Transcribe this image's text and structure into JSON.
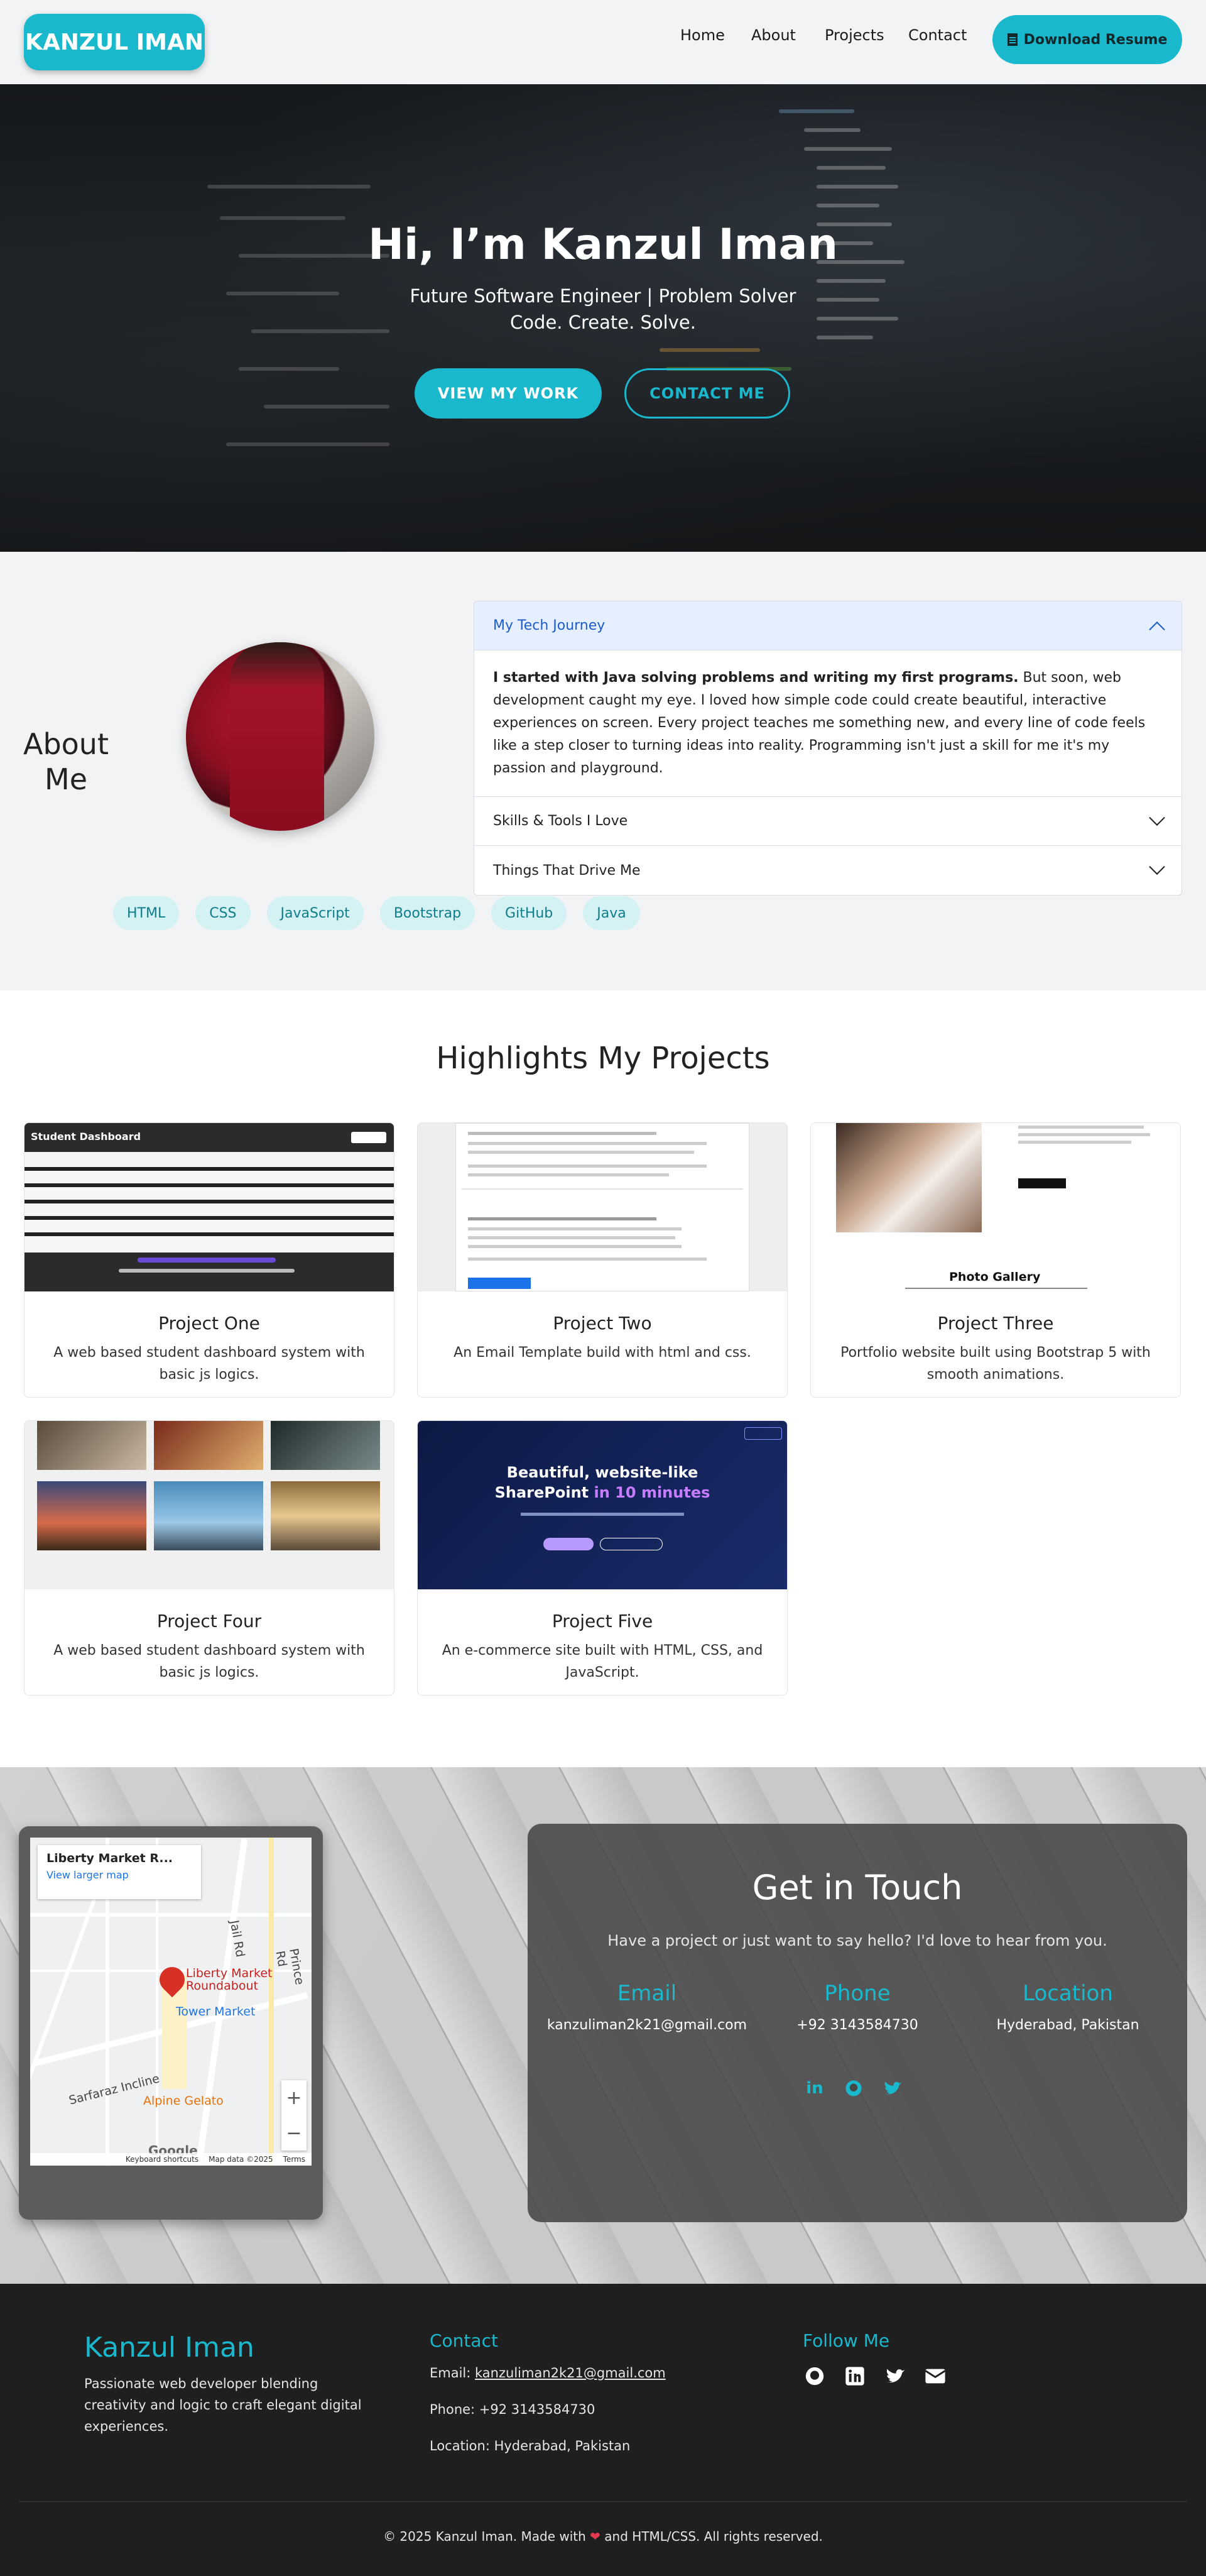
{
  "nav": {
    "brand": "KANZUL IMAN",
    "links": [
      "Home",
      "About",
      "Projects",
      "Contact"
    ],
    "resume_label": "Download Resume"
  },
  "hero": {
    "title": "Hi, I’m Kanzul Iman",
    "subtitle_1": "Future Software Engineer | Problem Solver",
    "subtitle_2": "Code. Create. Solve.",
    "primary_btn": "VIEW MY WORK",
    "secondary_btn": "CONTACT ME"
  },
  "about": {
    "title": "About Me",
    "accordion": {
      "open_title": "My Tech Journey",
      "open_body_bold": "I started with Java solving problems and writing my first programs.",
      "open_body_rest": " But soon, web development caught my eye. I loved how simple code could create beautiful, interactive experiences on screen. Every project teaches me something new, and every line of code feels like a step closer to turning ideas into reality. Programming isn't just a skill for me it's my passion and playground.",
      "item_2": "Skills & Tools I Love",
      "item_3": "Things That Drive Me"
    },
    "skills": [
      "HTML",
      "CSS",
      "JavaScript",
      "Bootstrap",
      "GitHub",
      "Java"
    ]
  },
  "projects": {
    "heading": "Highlights My Projects",
    "items": [
      {
        "title": "Project One",
        "desc": "A web based student dashboard system with basic js logics."
      },
      {
        "title": "Project Two",
        "desc": "An Email Template build with html and css."
      },
      {
        "title": "Project Three",
        "desc": "Portfolio website built using Bootstrap 5 with smooth animations."
      },
      {
        "title": "Project Four",
        "desc": "A web based student dashboard system with basic js logics."
      },
      {
        "title": "Project Five",
        "desc": "An e-commerce site built with HTML, CSS, and JavaScript."
      }
    ],
    "thumb_texts": {
      "p1_header": "Student Dashboard",
      "p5_headline_1": "Beautiful, website-like",
      "p5_headline_2": "SharePoint",
      "p5_headline_3": "in 10 minutes",
      "p3_gallery": "Photo Gallery"
    }
  },
  "contact": {
    "map": {
      "place": "Liberty Market R...",
      "larger_link": "View larger map",
      "label_liberty": "Liberty Market Roundabout",
      "label_tower": "Tower Market",
      "label_alpine": "Alpine Gelato",
      "label_sarfaraz": "Sarfaraz Incline",
      "label_jail": "Jail Rd",
      "label_prince": "Prince Rd",
      "label_google": "Google",
      "footer_shortcuts": "Keyboard shortcuts",
      "footer_data": "Map data ©2025",
      "footer_terms": "Terms"
    },
    "title": "Get in Touch",
    "subtitle": "Have a project or just want to say hello? I'd love to hear from you.",
    "email_label": "Email",
    "email_value": "kanzuliman2k21@gmail.com",
    "phone_label": "Phone",
    "phone_value": "+92 3143584730",
    "location_label": "Location",
    "location_value": "Hyderabad, Pakistan",
    "social_icons": [
      "linkedin-icon",
      "github-icon",
      "twitter-icon"
    ]
  },
  "footer": {
    "brand": "Kanzul Iman",
    "tagline": "Passionate web developer blending creativity and logic to craft elegant digital experiences.",
    "contact_heading": "Contact",
    "email_prefix": "Email: ",
    "email": "kanzuliman2k21@gmail.com",
    "phone": "Phone: +92 3143584730",
    "location": "Location: Hyderabad, Pakistan",
    "follow_heading": "Follow Me",
    "copyright_pre": "© 2025 Kanzul Iman. Made with",
    "copyright_post": "and HTML/CSS. All rights reserved."
  },
  "colors": {
    "accent": "#1ab8cc",
    "dark": "#1f1f1f",
    "light_bg": "#f2f3f5"
  }
}
